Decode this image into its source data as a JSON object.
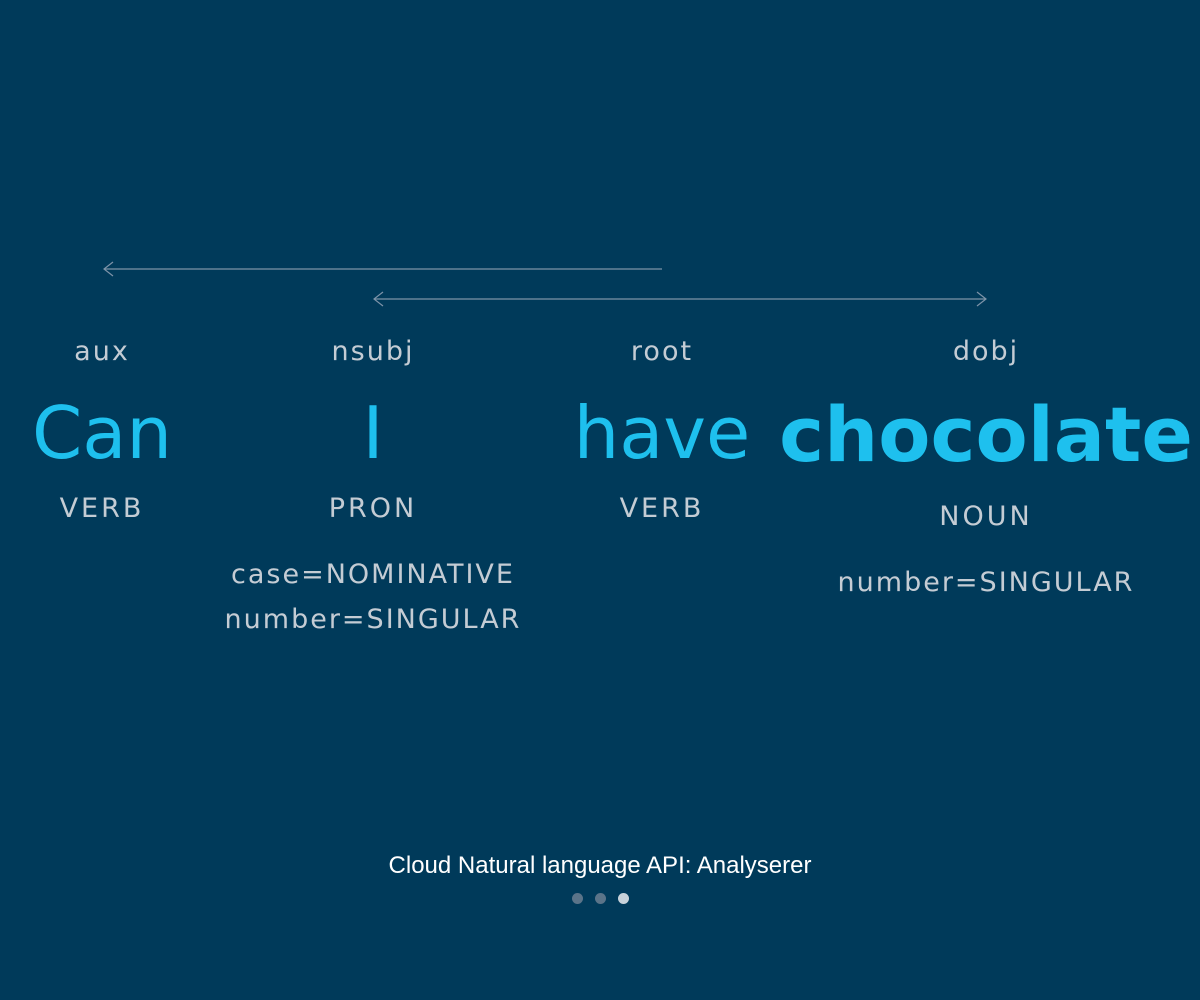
{
  "tokens": [
    {
      "relation": "aux",
      "word": "Can",
      "pos": "VERB",
      "features": []
    },
    {
      "relation": "nsubj",
      "word": "I",
      "pos": "PRON",
      "features": [
        "case=NOMINATIVE",
        "number=SINGULAR"
      ]
    },
    {
      "relation": "root",
      "word": "have",
      "pos": "VERB",
      "features": []
    },
    {
      "relation": "dobj",
      "word": "chocolate",
      "pos": "NOUN",
      "features": [
        "number=SINGULAR"
      ]
    }
  ],
  "caption": "Cloud Natural language API: Analyserer",
  "pager": {
    "count": 3,
    "active": 3
  },
  "colors": {
    "background": "#003a5a",
    "word": "#1ec0ee",
    "label": "#c4ccd4",
    "arc": "#7d93a8"
  }
}
